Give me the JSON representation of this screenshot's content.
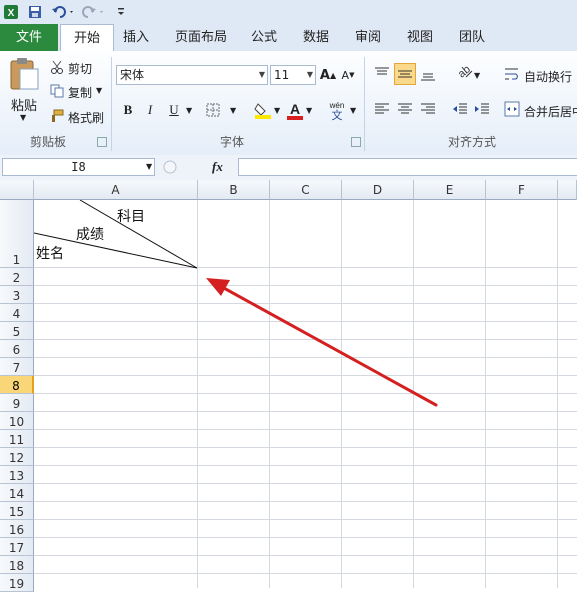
{
  "qat": {
    "app_icon": "excel-icon",
    "save_icon": "save-icon",
    "undo_icon": "undo-icon",
    "redo_icon": "redo-icon",
    "customize_icon": "customize-icon"
  },
  "tabs": {
    "file": "文件",
    "home": "开始",
    "insert": "插入",
    "page_layout": "页面布局",
    "formulas": "公式",
    "data": "数据",
    "review": "审阅",
    "view": "视图",
    "team": "团队"
  },
  "clipboard": {
    "paste": "粘贴",
    "cut": "剪切",
    "copy": "复制",
    "format_painter": "格式刷",
    "group": "剪贴板"
  },
  "font": {
    "name": "宋体",
    "size": "11",
    "bold": "B",
    "italic": "I",
    "underline": "U",
    "group": "字体"
  },
  "alignment": {
    "wrap_text": "自动换行",
    "merge_center": "合并后居中",
    "group": "对齐方式"
  },
  "formula_bar": {
    "name_box": "I8",
    "fx": "fx",
    "value": ""
  },
  "columns": [
    "A",
    "B",
    "C",
    "D",
    "E",
    "F"
  ],
  "rows": [
    "1",
    "2",
    "3",
    "4",
    "5",
    "6",
    "7",
    "8",
    "9",
    "10",
    "11",
    "12",
    "13",
    "14",
    "15",
    "16",
    "17",
    "18",
    "19"
  ],
  "selected_row": "8",
  "cell_a1": {
    "subject": "科目",
    "score": "成绩",
    "name": "姓名"
  },
  "arrow_color": "#d42020",
  "accent": {
    "file_tab": "#2b8a3e",
    "selected_header": "#f9d778"
  }
}
